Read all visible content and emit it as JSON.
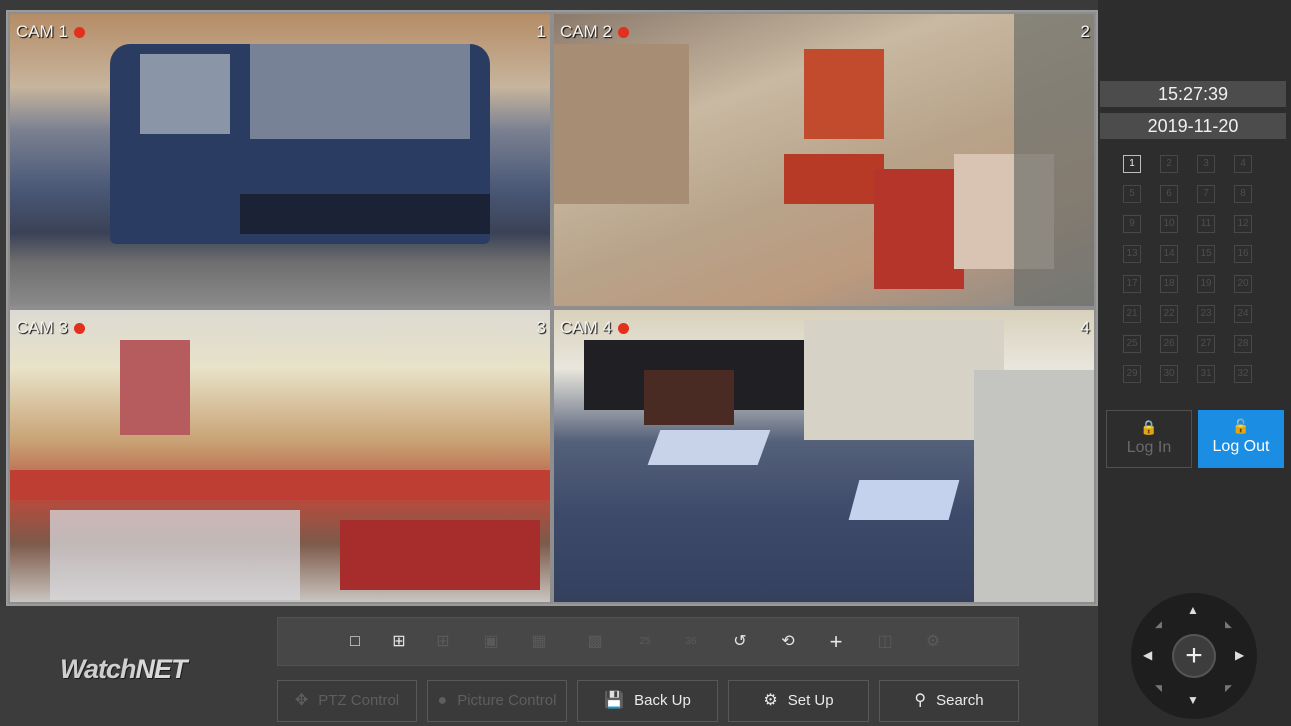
{
  "cameras": [
    {
      "label": "CAM 1",
      "number": "1",
      "recording": true
    },
    {
      "label": "CAM 2",
      "number": "2",
      "recording": true
    },
    {
      "label": "CAM 3",
      "number": "3",
      "recording": true
    },
    {
      "label": "CAM 4",
      "number": "4",
      "recording": true
    }
  ],
  "sidebar": {
    "time": "15:27:39",
    "date": "2019-11-20",
    "channels": [
      "1",
      "2",
      "3",
      "4",
      "5",
      "6",
      "7",
      "8",
      "9",
      "10",
      "11",
      "12",
      "13",
      "14",
      "15",
      "16",
      "17",
      "18",
      "19",
      "20",
      "21",
      "22",
      "23",
      "24",
      "25",
      "26",
      "27",
      "28",
      "29",
      "30",
      "31",
      "32"
    ],
    "active_channel": "1",
    "login_label": "Log In",
    "logout_label": "Log Out"
  },
  "brand": {
    "logo_watch": "Watch",
    "logo_net": "NET"
  },
  "toolbar": {
    "layout_icons": [
      "layout-1-icon",
      "layout-4-icon",
      "layout-6-icon",
      "layout-8-icon",
      "layout-9-icon",
      "layout-16-icon",
      "layout-25-icon",
      "layout-36-icon"
    ],
    "layout_25_label": "25",
    "layout_36_label": "36"
  },
  "buttons": {
    "ptz": "PTZ Control",
    "picture": "Picture Control",
    "backup": "Back Up",
    "setup": "Set Up",
    "search": "Search"
  },
  "colors": {
    "accent": "#1b8de2",
    "recording": "#e0301e"
  }
}
